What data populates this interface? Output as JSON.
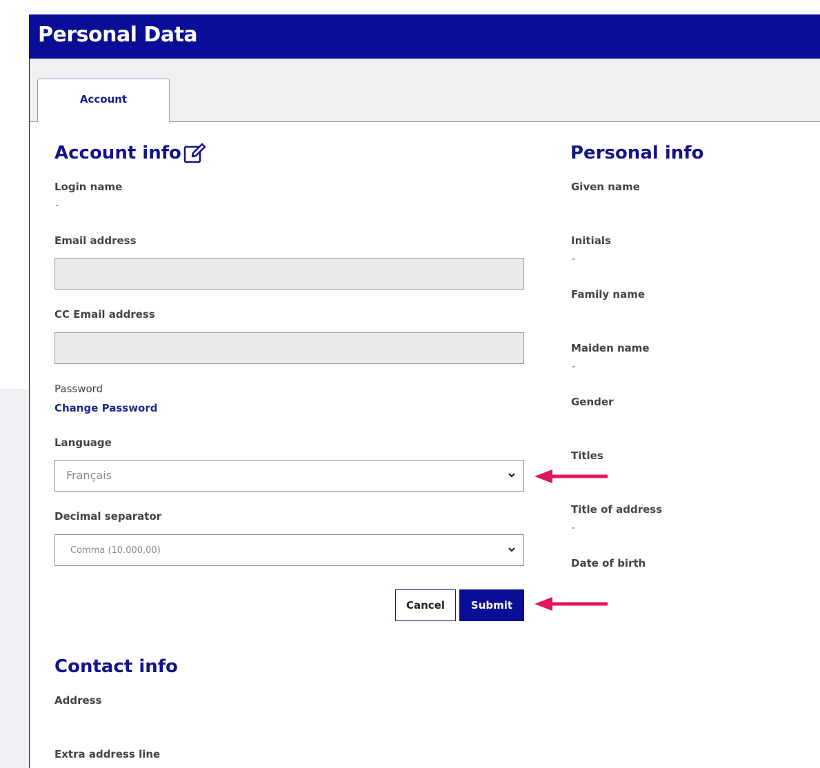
{
  "header": {
    "title": "Personal Data"
  },
  "tabs": [
    {
      "label": "Account"
    }
  ],
  "account_info": {
    "heading": "Account info",
    "login_label": "Login name",
    "login_value": "-",
    "email_label": "Email address",
    "email_value": "",
    "cc_email_label": "CC Email address",
    "cc_email_value": "",
    "password_label": "Password",
    "change_password_link": "Change Password",
    "language_label": "Language",
    "language_value": "Français",
    "decimal_label": "Decimal separator",
    "decimal_value": "Comma (10.000,00)",
    "cancel_label": "Cancel",
    "submit_label": "Submit"
  },
  "personal_info": {
    "heading": "Personal info",
    "given_name_label": "Given name",
    "initials_label": "Initials",
    "initials_value": "-",
    "family_name_label": "Family name",
    "maiden_name_label": "Maiden name",
    "maiden_name_value": "-",
    "gender_label": "Gender",
    "titles_label": "Titles",
    "title_of_address_label": "Title of address",
    "title_of_address_value": "-",
    "date_of_birth_label": "Date of birth"
  },
  "contact_info": {
    "heading": "Contact info",
    "address_label": "Address",
    "extra_address_label": "Extra address line"
  },
  "colors": {
    "brand": "#0a0e96",
    "annotation_arrow": "#e0185a"
  },
  "icons": {
    "edit": "edit-icon",
    "chevron": "chevron-down-icon",
    "arrow": "arrow-left-icon"
  }
}
